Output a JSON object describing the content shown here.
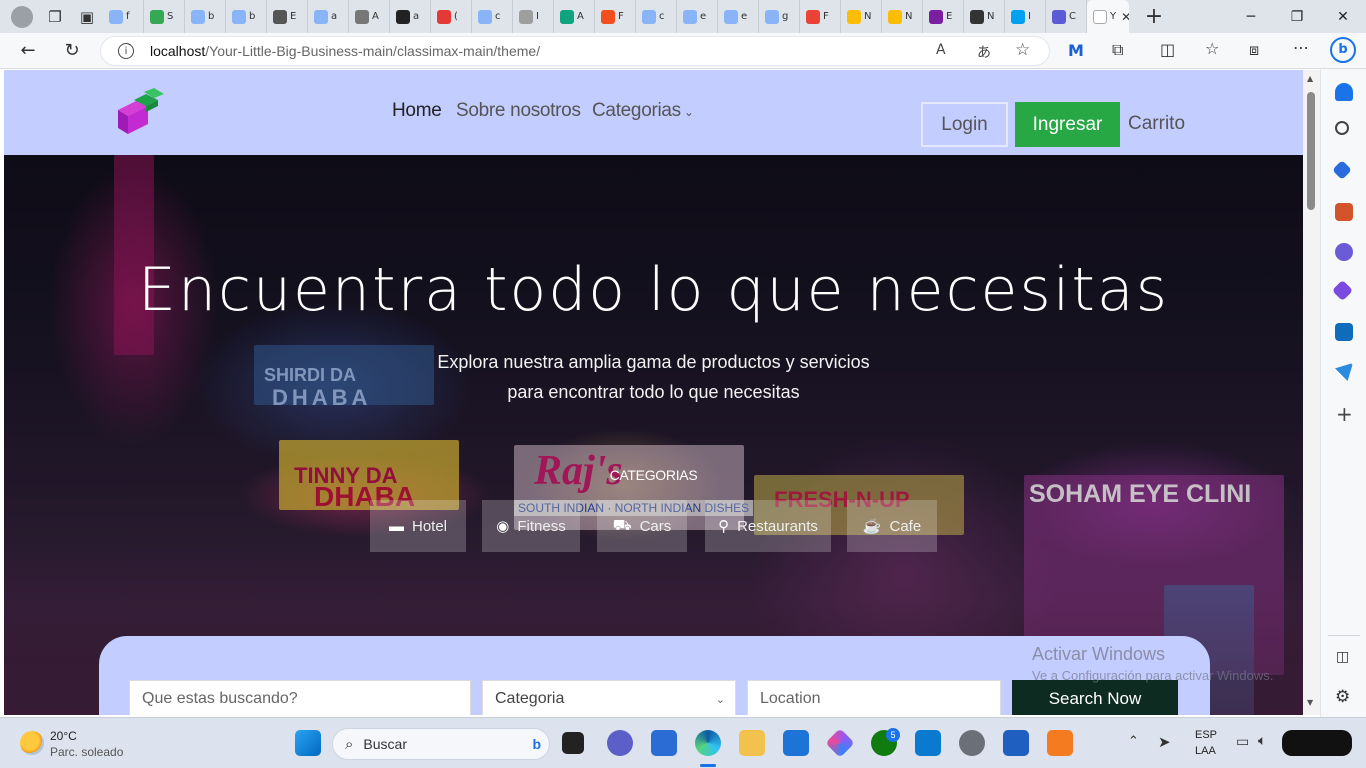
{
  "browser": {
    "tabs": [
      {
        "label": "f",
        "color": "#8ab4f8"
      },
      {
        "label": "S",
        "color": "#34a853"
      },
      {
        "label": "b",
        "color": "#8ab4f8"
      },
      {
        "label": "b",
        "color": "#8ab4f8"
      },
      {
        "label": "E",
        "color": "#555555"
      },
      {
        "label": "a",
        "color": "#8ab4f8"
      },
      {
        "label": "A",
        "color": "#777777"
      },
      {
        "label": "a",
        "color": "#222222"
      },
      {
        "label": "(",
        "color": "#e53935"
      },
      {
        "label": "c",
        "color": "#8ab4f8"
      },
      {
        "label": "I",
        "color": "#9e9e9e"
      },
      {
        "label": "A",
        "color": "#10a37f"
      },
      {
        "label": "F",
        "color": "#f24e1e"
      },
      {
        "label": "c",
        "color": "#8ab4f8"
      },
      {
        "label": "e",
        "color": "#8ab4f8"
      },
      {
        "label": "e",
        "color": "#8ab4f8"
      },
      {
        "label": "g",
        "color": "#8ab4f8"
      },
      {
        "label": "F",
        "color": "#ea4335"
      },
      {
        "label": "N",
        "color": "#fbbc04"
      },
      {
        "label": "N",
        "color": "#fbbc04"
      },
      {
        "label": "E",
        "color": "#7b1fa2"
      },
      {
        "label": "N",
        "color": "#333333"
      },
      {
        "label": "I",
        "color": "#00a1f1"
      },
      {
        "label": "C",
        "color": "#5b5bd6"
      },
      {
        "label": "Y",
        "color": "#ffffff",
        "active": true
      }
    ],
    "url_host": "localhost",
    "url_path": "/Your-Little-Big-Business-main/classimax-main/theme/"
  },
  "navbar": {
    "links": [
      "Home",
      "Sobre nosotros",
      "Categorias"
    ],
    "login": "Login",
    "ingresar": "Ingresar",
    "carrito": "Carrito"
  },
  "hero": {
    "title": "Encuentra todo lo que necesitas",
    "subtitle_line1": "Explora nuestra amplia gama de productos y servicios",
    "subtitle_line2": "para encontrar todo lo que necesitas",
    "categories_heading": "CATEGORIAS",
    "categories": [
      {
        "label": "Hotel",
        "icon": "bed-icon",
        "glyph": "▬"
      },
      {
        "label": "Fitness",
        "icon": "fitness-icon",
        "glyph": "◉"
      },
      {
        "label": "Cars",
        "icon": "car-icon",
        "glyph": "⛟"
      },
      {
        "label": "Restaurants",
        "icon": "cutlery-icon",
        "glyph": "⚲"
      },
      {
        "label": "Cafe",
        "icon": "coffee-icon",
        "glyph": "☕"
      }
    ],
    "signs": [
      "TINNY DA",
      "DHABA",
      "SOHAM EYE CLINI",
      "Raj's",
      "SOUTH INDIAN · NORTH INDIAN DISHES",
      "FRESH-N-UP",
      "SHIRDI DA",
      "DHABA"
    ]
  },
  "search": {
    "query_placeholder": "Que estas buscando?",
    "category_value": "Categoria",
    "location_placeholder": "Location",
    "submit_label": "Search Now"
  },
  "watermark": {
    "line1": "Activar Windows",
    "line2": "Ve a Configuración para activar Windows."
  },
  "taskbar": {
    "weather_temp": "20°C",
    "weather_desc": "Parc. soleado",
    "search_label": "Buscar",
    "lang1": "ESP",
    "lang2": "LAA",
    "badge_count": "5"
  }
}
